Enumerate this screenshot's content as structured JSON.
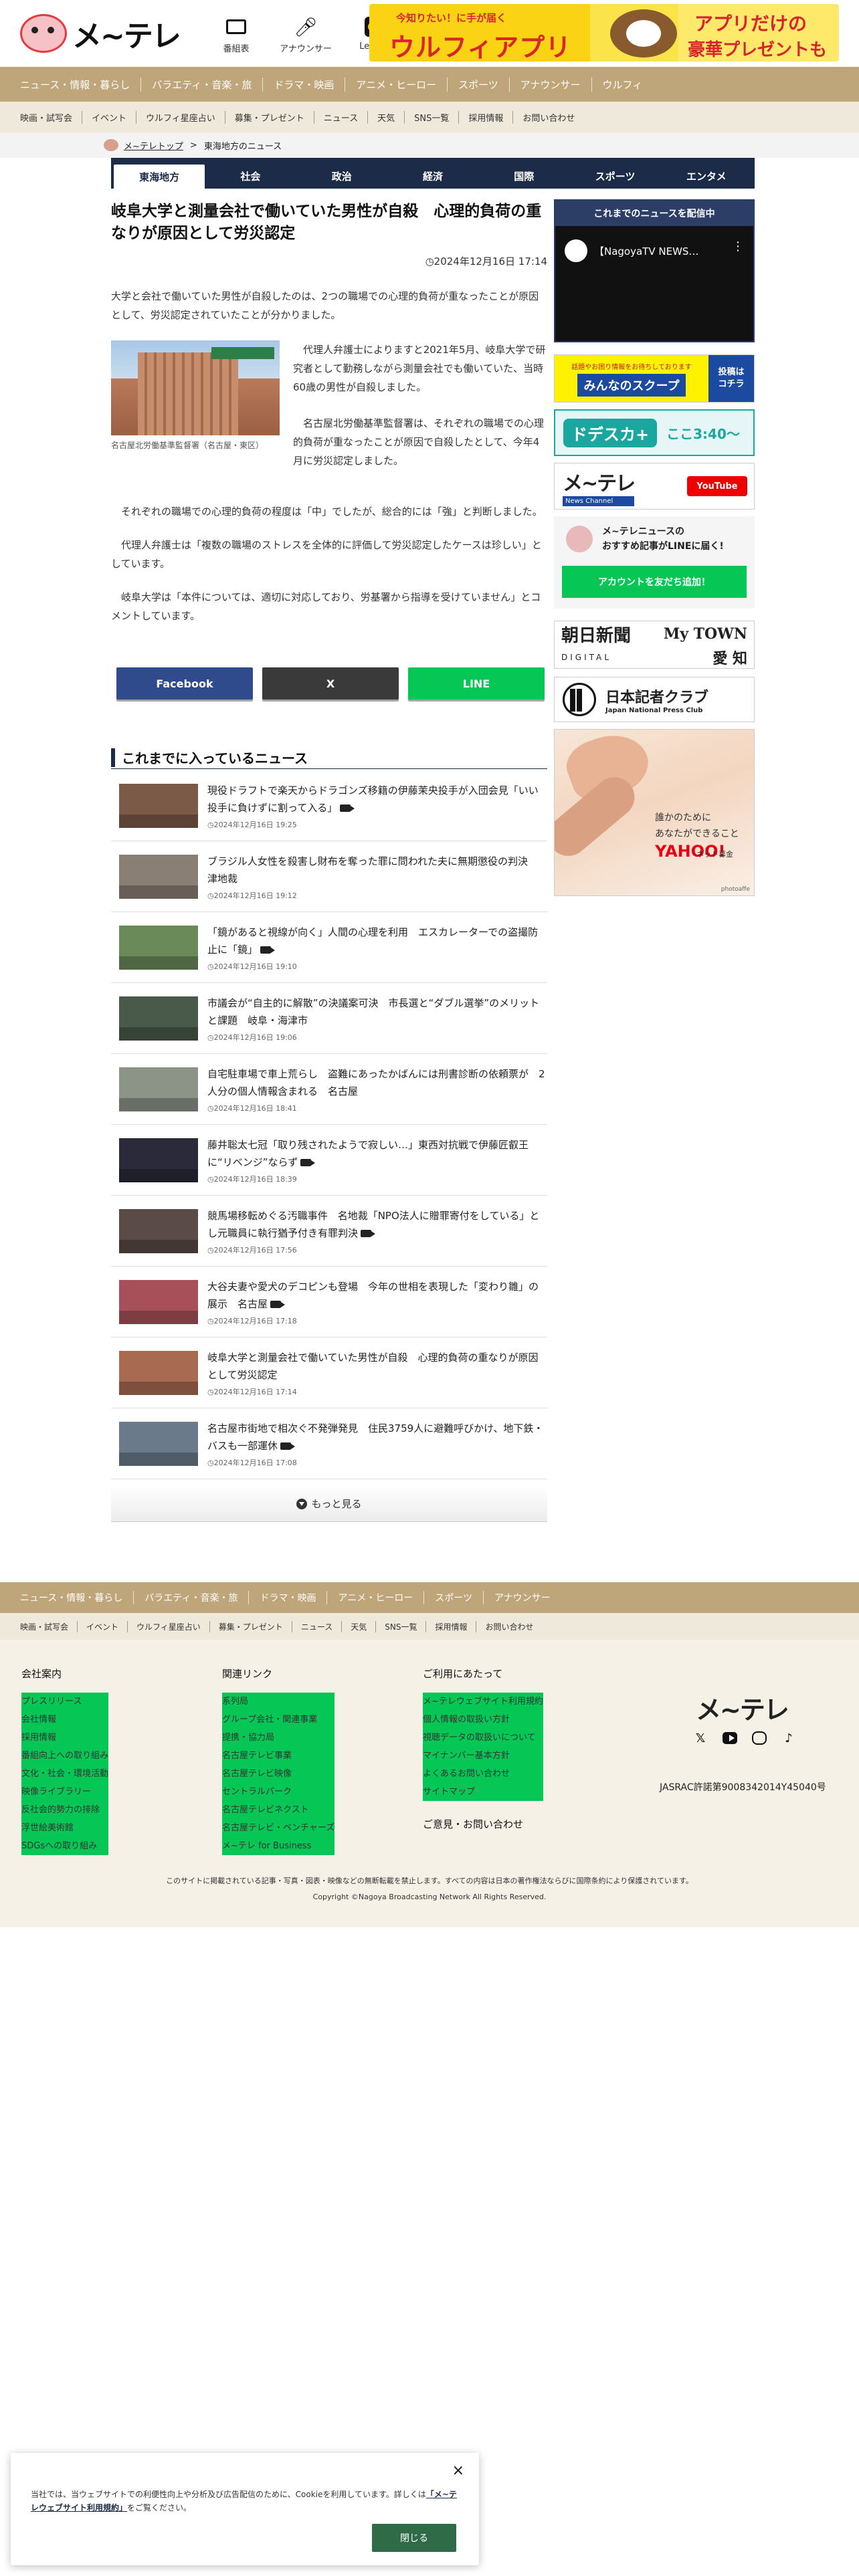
{
  "header": {
    "logo_text": "メ~テレ",
    "icons": [
      {
        "label": "番組表",
        "icon": "tv-icon"
      },
      {
        "label": "アナウンサー",
        "icon": "microphone-icon"
      },
      {
        "label": "Lemino",
        "icon": "lemino-icon"
      }
    ],
    "banner": {
      "line1": "今知りたい！に手が届く",
      "line2": "ウルフィアプリ",
      "line3": "アプリだけの",
      "line4": "豪華プレゼントも"
    }
  },
  "nav_primary": [
    "ニュース・情報・暮らし",
    "バラエティ・音楽・旅",
    "ドラマ・映画",
    "アニメ・ヒーロー",
    "スポーツ",
    "アナウンサー",
    "ウルフィ"
  ],
  "nav_secondary": [
    "映画・試写会",
    "イベント",
    "ウルフィ星座占い",
    "募集・プレゼント",
    "ニュース",
    "天気",
    "SNS一覧",
    "採用情報",
    "お問い合わせ"
  ],
  "breadcrumb": {
    "home": "メ~テレトップ",
    "separator": ">",
    "current": "東海地方のニュース"
  },
  "tabs": [
    {
      "label": "東海地方",
      "active": true
    },
    {
      "label": "社会",
      "active": false
    },
    {
      "label": "政治",
      "active": false
    },
    {
      "label": "経済",
      "active": false
    },
    {
      "label": "国際",
      "active": false
    },
    {
      "label": "スポーツ",
      "active": false
    },
    {
      "label": "エンタメ",
      "active": false
    }
  ],
  "article": {
    "title": "岐阜大学と測量会社で働いていた男性が自殺　心理的負荷の重なりが原因として労災認定",
    "date": "2024年12月16日 17:14",
    "lead": "大学と会社で働いていた男性が自殺したのは、2つの職場での心理的負荷が重なったことが原因として、労災認定されていたことが分かりました。",
    "photo_caption": "名古屋北労働基準監督署（名古屋・東区）",
    "side_paragraphs": [
      "代理人弁護士によりますと2021年5月、岐阜大学で研究者として勤務しながら測量会社でも働いていた、当時60歳の男性が自殺しました。",
      "名古屋北労働基準監督署は、それぞれの職場での心理的負荷が重なったことが原因で自殺したとして、今年4月に労災認定しました。"
    ],
    "paragraphs": [
      "それぞれの職場での心理的負荷の程度は「中」でしたが、総合的には「強」と判断しました。",
      "代理人弁護士は「複数の職場のストレスを全体的に評価して労災認定したケースは珍しい」としています。",
      "岐阜大学は「本件については、適切に対応しており、労基署から指導を受けていません」とコメントしています。"
    ]
  },
  "share": {
    "facebook": "Facebook",
    "x": "X",
    "line": "LINE"
  },
  "news": {
    "heading": "これまでに入っているニュース",
    "items": [
      {
        "title": "現役ドラフトで楽天からドラゴンズ移籍の伊藤茉央投手が入団会見「いい投手に負けずに割って入る」",
        "date": "2024年12月16日 19:25",
        "video": true,
        "color": "#7c5a48"
      },
      {
        "title": "ブラジル人女性を殺害し財布を奪った罪に問われた夫に無期懲役の判決　津地裁",
        "date": "2024年12月16日 19:12",
        "video": false,
        "color": "#8a7f74"
      },
      {
        "title": "「鏡があると視線が向く」人間の心理を利用　エスカレーターでの盗撮防止に「鏡」",
        "date": "2024年12月16日 19:10",
        "video": true,
        "color": "#6a8a5a"
      },
      {
        "title": "市議会が“自主的に解散”の決議案可決　市長選と“ダブル選挙”のメリットと課題　岐阜・海津市",
        "date": "2024年12月16日 19:06",
        "video": false,
        "color": "#4a5a4a"
      },
      {
        "title": "自宅駐車場で車上荒らし　盗難にあったかばんには刑書診断の依頼票が　2人分の個人情報含まれる　名古屋",
        "date": "2024年12月16日 18:41",
        "video": false,
        "color": "#8c9488"
      },
      {
        "title": "藤井聡太七冠「取り残されたようで寂しい…」東西対抗戦で伊藤匠叡王に“リベンジ”ならず",
        "date": "2024年12月16日 18:39",
        "video": true,
        "color": "#2a2a3a"
      },
      {
        "title": "競馬場移転めぐる汚職事件　名地裁「NPO法人に贈罪寄付をしている」とし元職員に執行猶予付き有罪判決",
        "date": "2024年12月16日 17:56",
        "video": true,
        "color": "#5a4a48"
      },
      {
        "title": "大谷夫妻や愛犬のデコピンも登場　今年の世相を表現した「変わり雛」の展示　名古屋",
        "date": "2024年12月16日 17:18",
        "video": true,
        "color": "#a8505a"
      },
      {
        "title": "岐阜大学と測量会社で働いていた男性が自殺　心理的負荷の重なりが原因として労災認定",
        "date": "2024年12月16日 17:14",
        "video": false,
        "color": "#a86a50"
      },
      {
        "title": "名古屋市街地で相次ぐ不発弾発見　住民3759人に避難呼びかけ、地下鉄・バスも一部運休",
        "date": "2024年12月16日 17:08",
        "video": true,
        "color": "#6a7a8a"
      }
    ],
    "more": "もっと見る"
  },
  "sidebar": {
    "video_heading": "これまでのニュースを配信中",
    "video_title": "【NagoyaTV NEWS…",
    "scoop_top": "話題やお困り情報をお待ちしております",
    "scoop_main": "みんなのスクープ",
    "scoop_side": "投稿は\nコチラ",
    "dodeska_name": "ドデスカ+",
    "dodeska_time": "ここ3:40～",
    "mtchan_name": "メ~テレ",
    "mtchan_sub": "News Channel",
    "mtchan_yt": "YouTube",
    "line_title": "メ~テレニュースの\nおすすめ記事がLINEに届く!",
    "line_button": "アカウントを友だち追加！",
    "asahi_1": "朝日新聞",
    "asahi_2": "My TOWN",
    "asahi_3": "DIGITAL",
    "asahi_4": "愛 知",
    "kisha_1": "日本記者クラブ",
    "kisha_2": "Japan National Press Club",
    "hands_1": "誰かのために",
    "hands_2": "あなたができること",
    "hands_3": "YAHOO!",
    "hands_4": "ネット募金",
    "hands_5": "photoaffe"
  },
  "footer": {
    "nav_primary": [
      "ニュース・情報・暮らし",
      "バラエティ・音楽・旅",
      "ドラマ・映画",
      "アニメ・ヒーロー",
      "スポーツ",
      "アナウンサー"
    ],
    "nav_secondary": [
      "映画・試写会",
      "イベント",
      "ウルフィ星座占い",
      "募集・プレゼント",
      "ニュース",
      "天気",
      "SNS一覧",
      "採用情報",
      "お問い合わせ"
    ],
    "col1": {
      "heading": "会社案内",
      "links": [
        "プレスリリース",
        "会社情報",
        "採用情報",
        "番組向上への取り組み",
        "文化・社会・環境活動",
        "映像ライブラリー",
        "反社会的勢力の排除",
        "浮世絵美術館",
        "SDGsへの取り組み"
      ]
    },
    "col2": {
      "heading": "関連リンク",
      "links": [
        "系列局",
        "グループ会社・関連事業",
        "提携・協力局",
        "名古屋テレビ事業",
        "名古屋テレビ映像",
        "セントラルパーク",
        "名古屋テレビネクスト",
        "名古屋テレビ・ベンチャーズ",
        "メ~テレ for Business"
      ]
    },
    "col3": {
      "heading": "ご利用にあたって",
      "links": [
        "メ~テレウェブサイト利用規約",
        "個人情報の取扱い方針",
        "視聴データの取扱いについて",
        "マイナンバー基本方針",
        "よくあるお問い合わせ",
        "サイトマップ"
      ],
      "extra": "ご意見・お問い合わせ"
    },
    "logo": "メ~テレ",
    "jasrac": "JASRAC許諾第9008342014Y45040号",
    "note": "このサイトに掲載されている記事・写真・図表・映像などの無断転載を禁止します。すべての内容は日本の著作権法ならびに国際条約により保護されています。",
    "copyright": "Copyright ©Nagoya Broadcasting Network All Rights Reserved."
  },
  "cookie": {
    "text_before": "当社では、当ウェブサイトでの利便性向上や分析及び広告配信のために、Cookieを利用しています。詳しくは「メ~テレウェブサイト利用規約」をご覧ください。",
    "link": "「メ~テレウェブサイト利用規約」",
    "close_button": "閉じる",
    "close_icon": "×"
  }
}
